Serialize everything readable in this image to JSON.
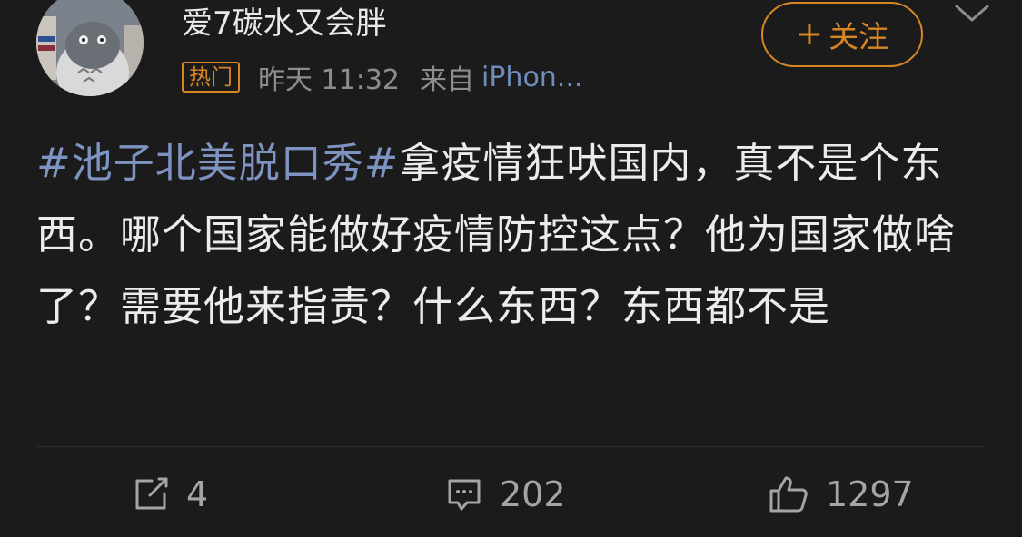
{
  "post": {
    "author": {
      "name": "爱7碳水又会胖",
      "avatar_icon": "totoro-avatar"
    },
    "badge": "热门",
    "time": "昨天 11:32",
    "source_label": "来自",
    "source_device": "iPhon...",
    "follow_button": {
      "plus": "+",
      "label": "关注"
    },
    "content": {
      "hashtag": "#池子北美脱口秀#",
      "text": "拿疫情狂吠国内，真不是个东西。哪个国家能做好疫情防控这点？他为国家做啥了？需要他来指责？什么东西？东西都不是"
    },
    "actions": {
      "repost_count": "4",
      "comment_count": "202",
      "like_count": "1297"
    }
  },
  "colors": {
    "background": "#1b1b1b",
    "accent": "#d78624",
    "hashtag": "#7e93c2",
    "secondary_text": "#8d8d8d"
  }
}
